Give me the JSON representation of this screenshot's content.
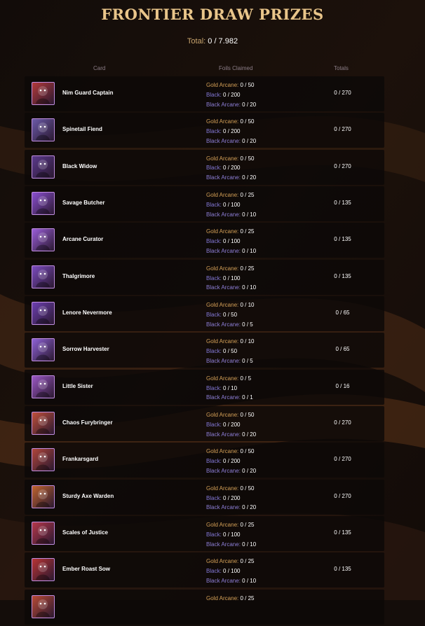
{
  "title": "FRONTIER DRAW PRIZES",
  "total": {
    "label": "Total:",
    "value": "0 / 7.982"
  },
  "columns": {
    "card": "Card",
    "foils": "Foils Claimed",
    "totals": "Totals"
  },
  "foil_labels": {
    "gold": "Gold Arcane:",
    "black": "Black:",
    "black_arcane": "Black Arcane:"
  },
  "colors": {
    "gold_text": "#e9c58a",
    "gold_label": "#d4a057",
    "black_label": "#8479d8",
    "avatar_border": "#c08de0"
  },
  "rows": [
    {
      "name": "Nim Guard Captain",
      "gold": "0 / 50",
      "black": "0 / 200",
      "black_arcane": "0 / 20",
      "total": "0 / 270",
      "icon": "nim-guard-captain-portrait-icon",
      "color": "#b23a3a"
    },
    {
      "name": "Spinetail Fiend",
      "gold": "0 / 50",
      "black": "0 / 200",
      "black_arcane": "0 / 20",
      "total": "0 / 270",
      "icon": "spinetail-fiend-portrait-icon",
      "color": "#6b5aa8"
    },
    {
      "name": "Black Widow",
      "gold": "0 / 50",
      "black": "0 / 200",
      "black_arcane": "0 / 20",
      "total": "0 / 270",
      "icon": "black-widow-portrait-icon",
      "color": "#5b3a8c"
    },
    {
      "name": "Savage Butcher",
      "gold": "0 / 25",
      "black": "0 / 100",
      "black_arcane": "0 / 10",
      "total": "0 / 135",
      "icon": "savage-butcher-portrait-icon",
      "color": "#8a4fd0"
    },
    {
      "name": "Arcane Curator",
      "gold": "0 / 25",
      "black": "0 / 100",
      "black_arcane": "0 / 10",
      "total": "0 / 135",
      "icon": "arcane-curator-portrait-icon",
      "color": "#9a5ed8"
    },
    {
      "name": "Thalgrimore",
      "gold": "0 / 25",
      "black": "0 / 100",
      "black_arcane": "0 / 10",
      "total": "0 / 135",
      "icon": "thalgrimore-portrait-icon",
      "color": "#7b4cc0"
    },
    {
      "name": "Lenore Nevermore",
      "gold": "0 / 10",
      "black": "0 / 50",
      "black_arcane": "0 / 5",
      "total": "0 / 65",
      "icon": "lenore-nevermore-portrait-icon",
      "color": "#6c3fb0"
    },
    {
      "name": "Sorrow Harvester",
      "gold": "0 / 10",
      "black": "0 / 50",
      "black_arcane": "0 / 5",
      "total": "0 / 65",
      "icon": "sorrow-harvester-portrait-icon",
      "color": "#8e62d6"
    },
    {
      "name": "Little Sister",
      "gold": "0 / 5",
      "black": "0 / 10",
      "black_arcane": "0 / 1",
      "total": "0 / 16",
      "icon": "little-sister-portrait-icon",
      "color": "#9b58c4"
    },
    {
      "name": "Chaos Furybringer",
      "gold": "0 / 50",
      "black": "0 / 200",
      "black_arcane": "0 / 20",
      "total": "0 / 270",
      "icon": "chaos-furybringer-portrait-icon",
      "color": "#c0503a"
    },
    {
      "name": "Frankarsgard",
      "gold": "0 / 50",
      "black": "0 / 200",
      "black_arcane": "0 / 20",
      "total": "0 / 270",
      "icon": "frankarsgard-portrait-icon",
      "color": "#b0463a"
    },
    {
      "name": "Sturdy Axe Warden",
      "gold": "0 / 50",
      "black": "0 / 200",
      "black_arcane": "0 / 20",
      "total": "0 / 270",
      "icon": "sturdy-axe-warden-portrait-icon",
      "color": "#c0642e"
    },
    {
      "name": "Scales of Justice",
      "gold": "0 / 25",
      "black": "0 / 100",
      "black_arcane": "0 / 10",
      "total": "0 / 135",
      "icon": "scales-of-justice-portrait-icon",
      "color": "#b5384a"
    },
    {
      "name": "Ember Roast Sow",
      "gold": "0 / 25",
      "black": "0 / 100",
      "black_arcane": "0 / 10",
      "total": "0 / 135",
      "icon": "ember-roast-sow-portrait-icon",
      "color": "#b83434"
    },
    {
      "name": "",
      "gold": "0 / 25",
      "black": "",
      "black_arcane": "",
      "total": "",
      "icon": "partial-card-portrait-icon",
      "color": "#b84a34"
    }
  ]
}
